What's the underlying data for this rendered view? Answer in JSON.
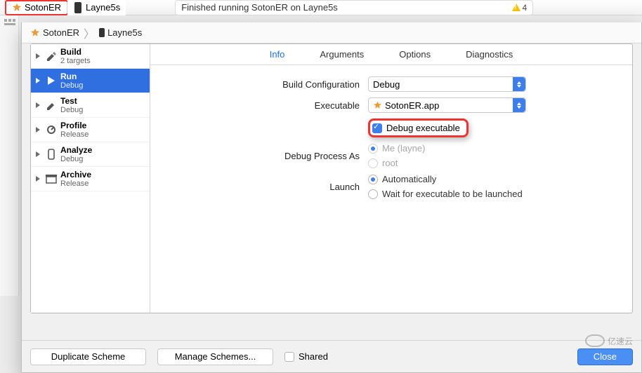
{
  "toolbar": {
    "scheme_name": "SotonER",
    "device_name": "Layne5s",
    "status_text": "Finished running SotonER on Layne5s",
    "warning_count": "4"
  },
  "breadcrumb": {
    "scheme": "SotonER",
    "target": "Layne5s"
  },
  "actions": [
    {
      "title": "Build",
      "sub": "2 targets"
    },
    {
      "title": "Run",
      "sub": "Debug"
    },
    {
      "title": "Test",
      "sub": "Debug"
    },
    {
      "title": "Profile",
      "sub": "Release"
    },
    {
      "title": "Analyze",
      "sub": "Debug"
    },
    {
      "title": "Archive",
      "sub": "Release"
    }
  ],
  "tabs": {
    "info": "Info",
    "arguments": "Arguments",
    "options": "Options",
    "diagnostics": "Diagnostics"
  },
  "form": {
    "build_config_label": "Build Configuration",
    "build_config_value": "Debug",
    "executable_label": "Executable",
    "executable_value": "SotonER.app",
    "debug_executable_label": "Debug executable",
    "debug_process_label": "Debug Process As",
    "process_me": "Me (layne)",
    "process_root": "root",
    "launch_label": "Launch",
    "launch_auto": "Automatically",
    "launch_wait": "Wait for executable to be launched"
  },
  "buttons": {
    "duplicate": "Duplicate Scheme",
    "manage": "Manage Schemes...",
    "shared": "Shared",
    "close": "Close"
  },
  "watermark": "亿速云"
}
